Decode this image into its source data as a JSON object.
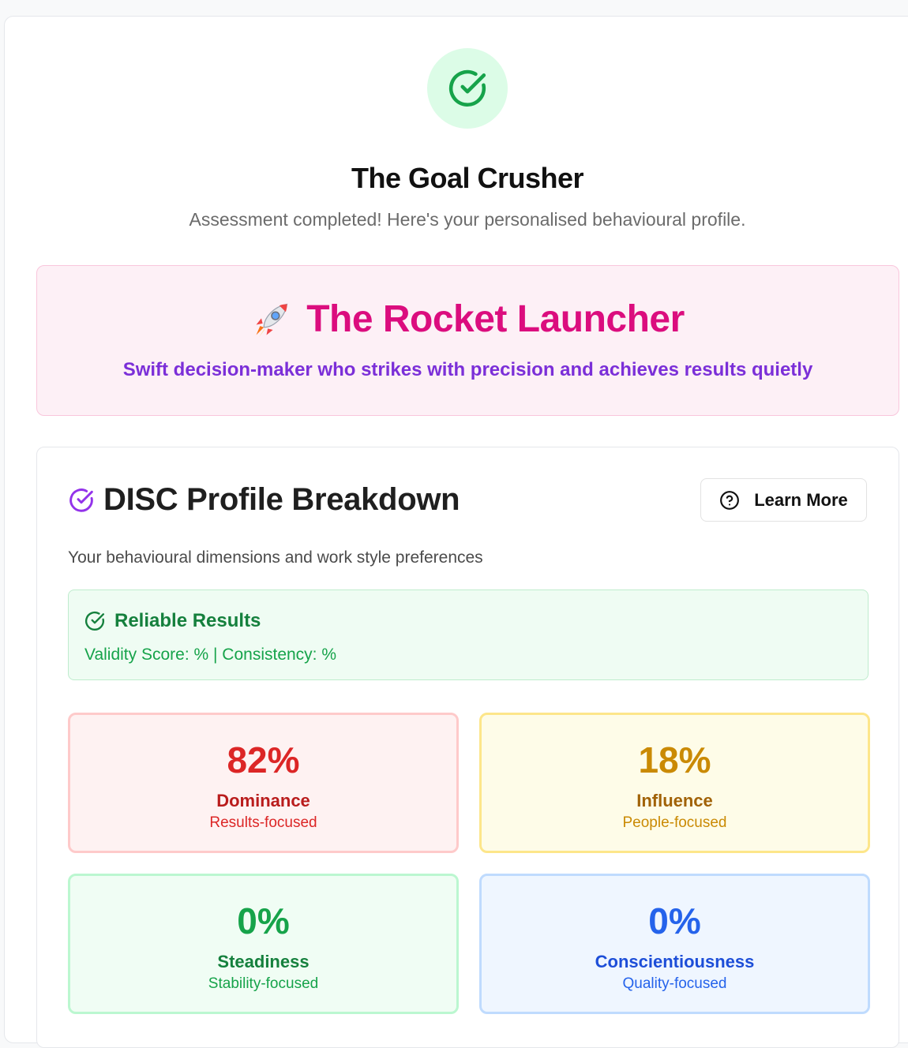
{
  "header": {
    "icon": "check-circle-icon",
    "title": "The Goal Crusher",
    "subtitle": "Assessment completed! Here's your personalised behavioural profile."
  },
  "archetype": {
    "icon": "rocket-icon",
    "title": "The Rocket Launcher",
    "description": "Swift decision-maker who strikes with precision and achieves results quietly"
  },
  "disc": {
    "icon": "check-circle-icon",
    "title": "DISC Profile Breakdown",
    "learn_more_label": "Learn More",
    "learn_more_icon": "help-circle-icon",
    "subtitle": "Your behavioural dimensions and work style preferences",
    "reliability": {
      "icon": "check-circle-icon",
      "title": "Reliable Results",
      "validity_label": "Validity Score: %",
      "separator": " | ",
      "consistency_label": "Consistency: %"
    },
    "scores": [
      {
        "percent": "82%",
        "name": "Dominance",
        "focus": "Results-focused",
        "color": "#dc2626"
      },
      {
        "percent": "18%",
        "name": "Influence",
        "focus": "People-focused",
        "color": "#ca8a04"
      },
      {
        "percent": "0%",
        "name": "Steadiness",
        "focus": "Stability-focused",
        "color": "#16a34a"
      },
      {
        "percent": "0%",
        "name": "Conscientiousness",
        "focus": "Quality-focused",
        "color": "#2563eb"
      }
    ]
  },
  "colors": {
    "archetype_title": "#db0d7e",
    "archetype_description": "#7b2fd8",
    "success_green": "#16a34a"
  }
}
